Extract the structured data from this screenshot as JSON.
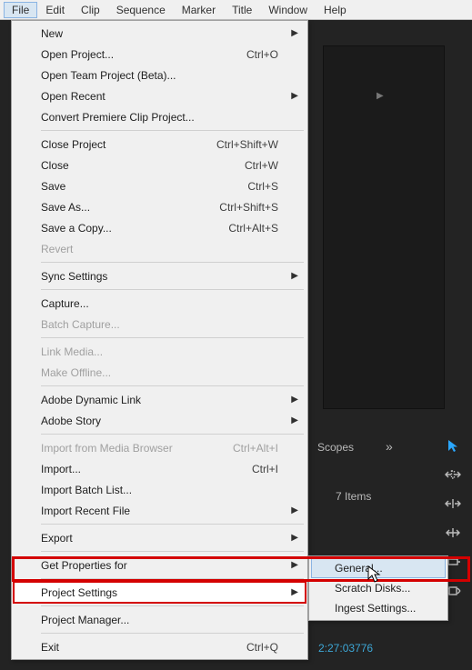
{
  "menubar": {
    "items": [
      {
        "label": "File",
        "active": true
      },
      {
        "label": "Edit"
      },
      {
        "label": "Clip"
      },
      {
        "label": "Sequence"
      },
      {
        "label": "Marker"
      },
      {
        "label": "Title"
      },
      {
        "label": "Window"
      },
      {
        "label": "Help"
      }
    ]
  },
  "file_menu": [
    {
      "type": "item",
      "label": "New",
      "arrow": true
    },
    {
      "type": "item",
      "label": "Open Project...",
      "shortcut": "Ctrl+O"
    },
    {
      "type": "item",
      "label": "Open Team Project (Beta)..."
    },
    {
      "type": "item",
      "label": "Open Recent",
      "arrow": true
    },
    {
      "type": "item",
      "label": "Convert Premiere Clip Project..."
    },
    {
      "type": "sep"
    },
    {
      "type": "item",
      "label": "Close Project",
      "shortcut": "Ctrl+Shift+W"
    },
    {
      "type": "item",
      "label": "Close",
      "shortcut": "Ctrl+W"
    },
    {
      "type": "item",
      "label": "Save",
      "shortcut": "Ctrl+S"
    },
    {
      "type": "item",
      "label": "Save As...",
      "shortcut": "Ctrl+Shift+S"
    },
    {
      "type": "item",
      "label": "Save a Copy...",
      "shortcut": "Ctrl+Alt+S"
    },
    {
      "type": "item",
      "label": "Revert",
      "disabled": true
    },
    {
      "type": "sep"
    },
    {
      "type": "item",
      "label": "Sync Settings",
      "arrow": true
    },
    {
      "type": "sep"
    },
    {
      "type": "item",
      "label": "Capture..."
    },
    {
      "type": "item",
      "label": "Batch Capture...",
      "disabled": true
    },
    {
      "type": "sep"
    },
    {
      "type": "item",
      "label": "Link Media...",
      "disabled": true
    },
    {
      "type": "item",
      "label": "Make Offline...",
      "disabled": true
    },
    {
      "type": "sep"
    },
    {
      "type": "item",
      "label": "Adobe Dynamic Link",
      "arrow": true
    },
    {
      "type": "item",
      "label": "Adobe Story",
      "arrow": true
    },
    {
      "type": "sep"
    },
    {
      "type": "item",
      "label": "Import from Media Browser",
      "shortcut": "Ctrl+Alt+I",
      "disabled": true
    },
    {
      "type": "item",
      "label": "Import...",
      "shortcut": "Ctrl+I"
    },
    {
      "type": "item",
      "label": "Import Batch List..."
    },
    {
      "type": "item",
      "label": "Import Recent File",
      "arrow": true
    },
    {
      "type": "sep"
    },
    {
      "type": "item",
      "label": "Export",
      "arrow": true
    },
    {
      "type": "sep"
    },
    {
      "type": "item",
      "label": "Get Properties for",
      "arrow": true
    },
    {
      "type": "sep"
    },
    {
      "type": "item",
      "label": "Project Settings",
      "arrow": true,
      "selected": true
    },
    {
      "type": "sep"
    },
    {
      "type": "item",
      "label": "Project Manager..."
    },
    {
      "type": "sep"
    },
    {
      "type": "item",
      "label": "Exit",
      "shortcut": "Ctrl+Q"
    }
  ],
  "project_settings_submenu": [
    {
      "label": "General...",
      "selected": true
    },
    {
      "label": "Scratch Disks..."
    },
    {
      "label": "Ingest Settings..."
    }
  ],
  "right_panel": {
    "scopes_label": "Scopes",
    "items_label": "7 Items",
    "timecode": "2:27:03776"
  }
}
